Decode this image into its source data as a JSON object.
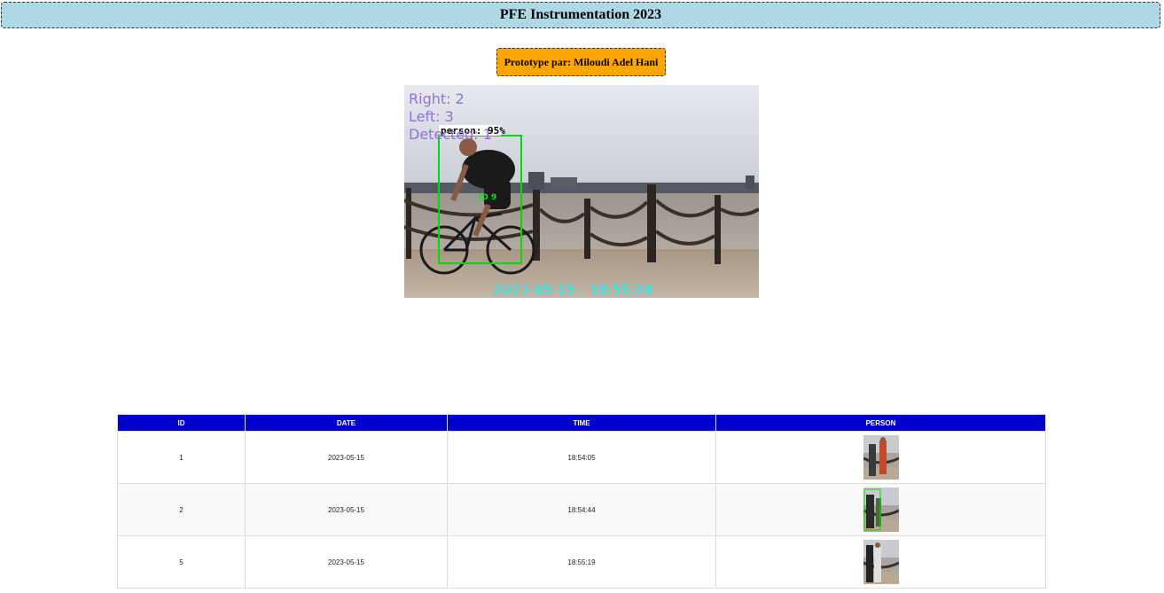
{
  "header": {
    "title": "PFE Instrumentation 2023"
  },
  "subheader": {
    "author": "Prototype par: Miloudi Adel Hani"
  },
  "video": {
    "overlay_right": "Right: 2",
    "overlay_left": "Left: 3",
    "overlay_detected": "Detected: 1",
    "label": "person: 95%",
    "track_id": "ID 9",
    "timestamp": "2023-05-15 - 18:55:24",
    "colors": {
      "overlay": "#9370db",
      "box": "#00dd00",
      "timestamp": "#00ffff"
    }
  },
  "table": {
    "headers": [
      "ID",
      "DATE",
      "TIME",
      "PERSON"
    ],
    "rows": [
      {
        "id": "1",
        "date": "2023-05-15",
        "time": "18:54:05",
        "person": "person-thumbnail"
      },
      {
        "id": "2",
        "date": "2023-05-15",
        "time": "18:54:44",
        "person": "person-thumbnail"
      },
      {
        "id": "5",
        "date": "2023-05-15",
        "time": "18:55:19",
        "person": "person-thumbnail"
      }
    ]
  }
}
